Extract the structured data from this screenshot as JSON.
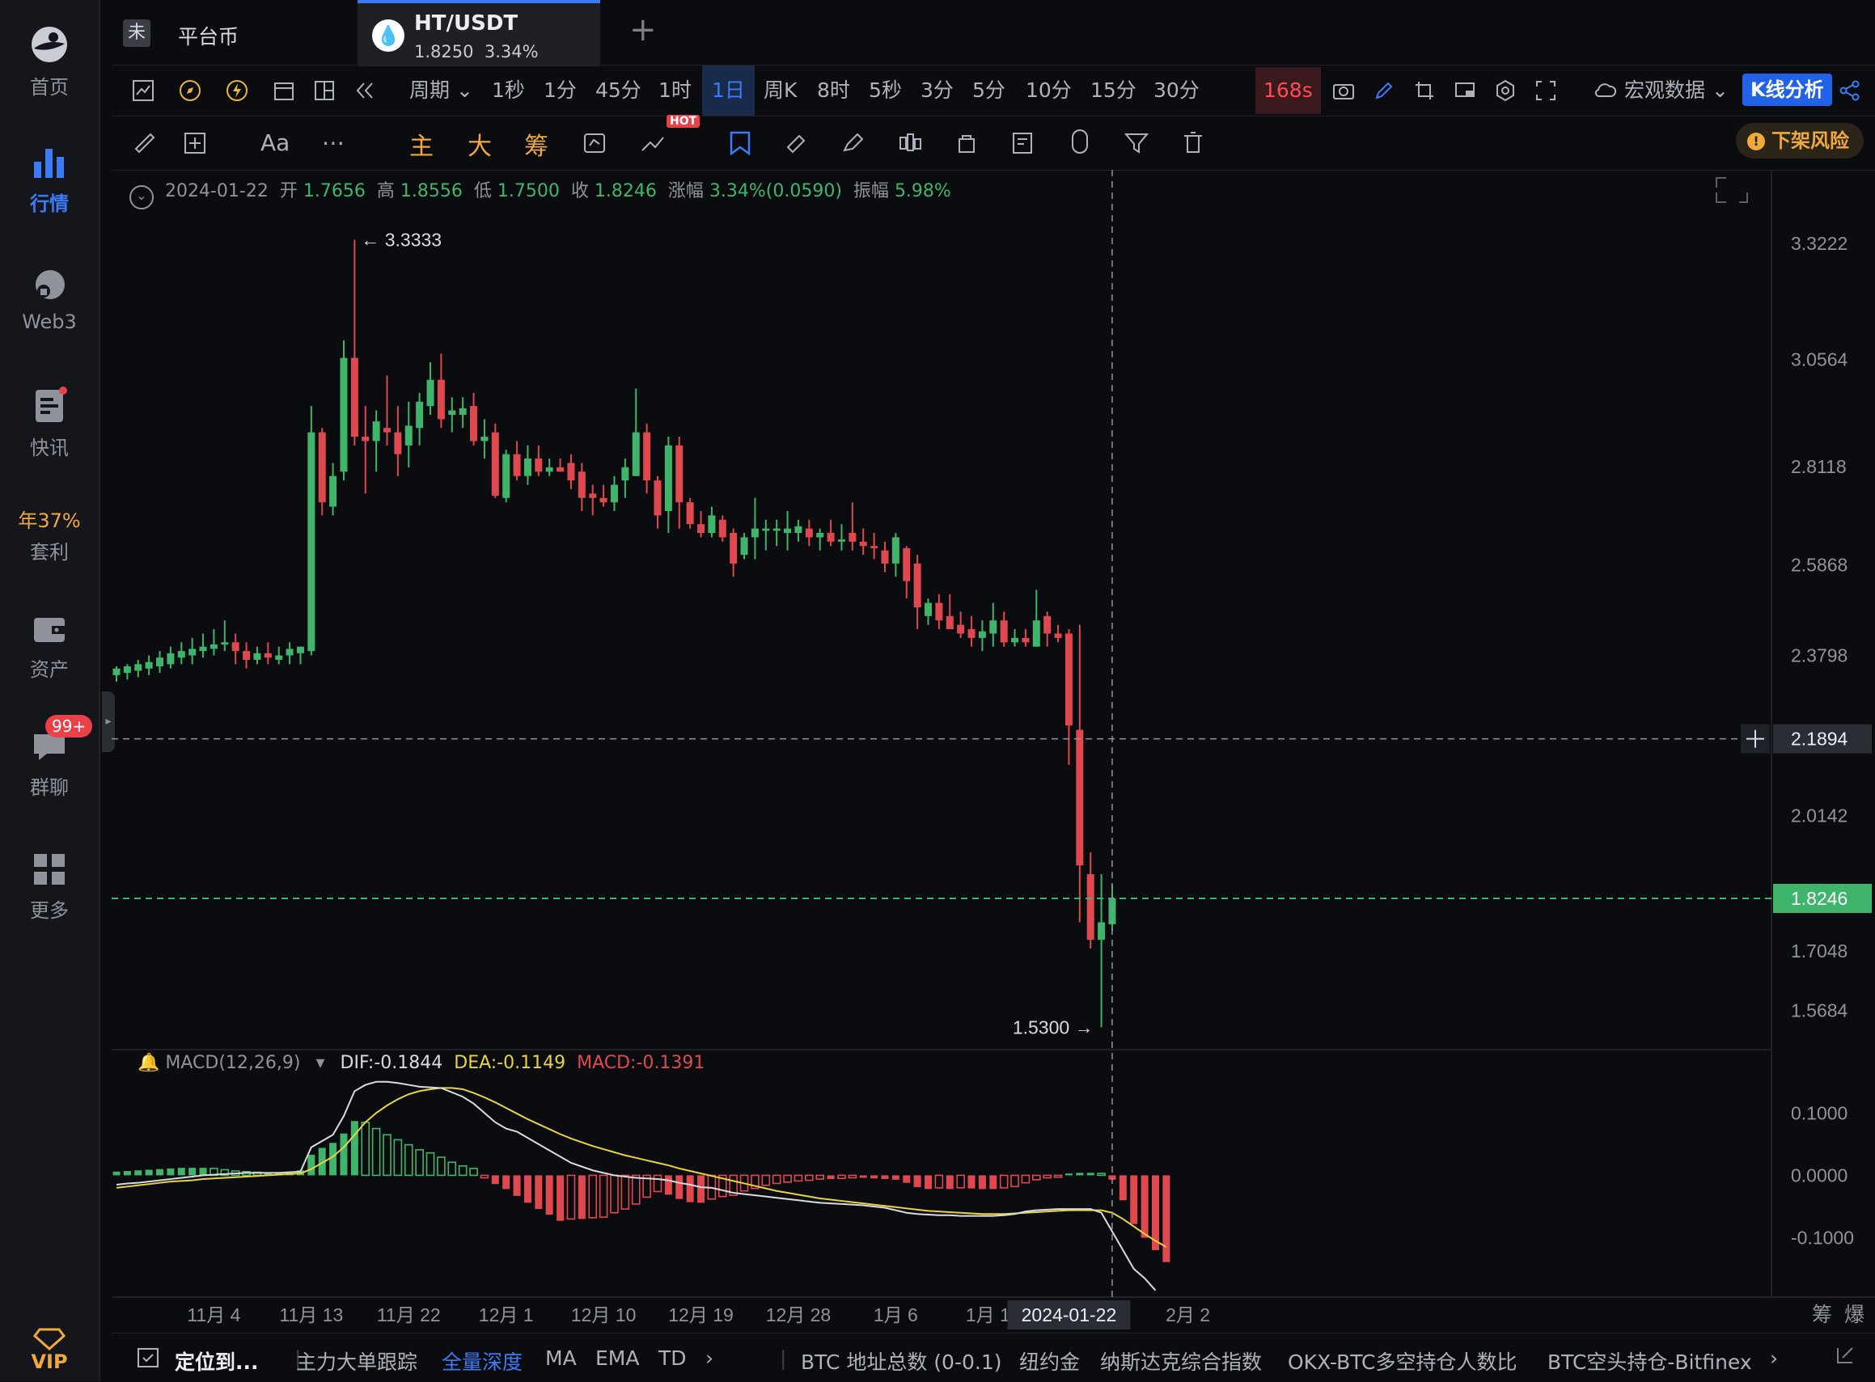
{
  "sidebar": {
    "items": [
      {
        "label": "首页",
        "icon": "home-logo-icon"
      },
      {
        "label": "行情",
        "icon": "market-bars-icon"
      },
      {
        "label": "Web3",
        "icon": "web3-icon"
      },
      {
        "label": "快讯",
        "icon": "news-icon"
      },
      {
        "label": "套利",
        "icon": "arbitrage-icon",
        "promo": "年37%"
      },
      {
        "label": "资产",
        "icon": "wallet-icon"
      },
      {
        "label": "群聊",
        "icon": "chat-icon",
        "badge": "99+"
      },
      {
        "label": "更多",
        "icon": "grid-more-icon"
      }
    ],
    "vip": "VIP"
  },
  "tabs": {
    "first": {
      "icon_char": "未",
      "label": "平台币"
    },
    "active": {
      "pair": "HT/USDT",
      "price": "1.8250",
      "change": "3.34%"
    },
    "add": "+"
  },
  "toolbar": {
    "period_label": "周期",
    "intervals": [
      "1秒",
      "1分",
      "45分",
      "1时",
      "1日",
      "周K",
      "8时",
      "5秒",
      "3分",
      "5分",
      "10分",
      "15分",
      "30分"
    ],
    "selected_interval": "1日",
    "timer": "168s",
    "macro_label": "宏观数据",
    "kline_analysis": "K线分析",
    "risk_label": "下架风险",
    "font_label": "Aa",
    "indicator_main": "主",
    "indicator_big": "大",
    "indicator_chips": "筹",
    "hot": "HOT"
  },
  "ohlc": {
    "date": "2024-01-22",
    "open_label": "开",
    "open": "1.7656",
    "high_label": "高",
    "high": "1.8556",
    "low_label": "低",
    "low": "1.7500",
    "close_label": "收",
    "close": "1.8246",
    "change_label": "涨幅",
    "change": "3.34%(0.0590)",
    "amp_label": "振幅",
    "amp": "5.98%"
  },
  "macd": {
    "label": "MACD(12,26,9)",
    "dif": "DIF:-0.1844",
    "dea": "DEA:-0.1149",
    "macd": "MACD:-0.1391"
  },
  "colors": {
    "up": "#3fb56b",
    "down": "#e0484f",
    "accent": "#3b7cf6",
    "dif": "#d9dbe0",
    "dea": "#e8d43b"
  },
  "chart_data": {
    "type": "candlestick",
    "title": "HT/USDT 1日",
    "y_ticks": [
      "3.3222",
      "3.0564",
      "2.8118",
      "2.5868",
      "2.3798",
      "2.1894",
      "2.0142",
      "1.8246",
      "1.7048",
      "1.5684"
    ],
    "y_tick_values": [
      3.3222,
      3.0564,
      2.8118,
      2.5868,
      2.3798,
      2.1894,
      2.0142,
      1.8246,
      1.7048,
      1.5684
    ],
    "ylim": [
      1.49,
      3.49
    ],
    "crosshair_price": "2.1894",
    "last_price": "1.8246",
    "high_marker": "← 3.3333",
    "low_marker": "1.5300 →",
    "x_ticks": [
      "11月 4",
      "11月 13",
      "11月 22",
      "12月 1",
      "12月 10",
      "12月 19",
      "12月 28",
      "1月 6",
      "1月 15",
      "2024-01-22",
      "2月 2"
    ],
    "x_tick_index": [
      9,
      18,
      27,
      36,
      45,
      54,
      63,
      72,
      81,
      88,
      99
    ],
    "ohlc": [
      [
        2.335,
        2.355,
        2.32,
        2.35
      ],
      [
        2.34,
        2.36,
        2.325,
        2.355
      ],
      [
        2.345,
        2.37,
        2.33,
        2.36
      ],
      [
        2.35,
        2.38,
        2.335,
        2.365
      ],
      [
        2.355,
        2.39,
        2.34,
        2.375
      ],
      [
        2.36,
        2.4,
        2.35,
        2.385
      ],
      [
        2.375,
        2.41,
        2.36,
        2.39
      ],
      [
        2.38,
        2.42,
        2.36,
        2.395
      ],
      [
        2.39,
        2.43,
        2.375,
        2.4
      ],
      [
        2.395,
        2.44,
        2.38,
        2.405
      ],
      [
        2.405,
        2.46,
        2.39,
        2.41
      ],
      [
        2.41,
        2.43,
        2.36,
        2.39
      ],
      [
        2.39,
        2.41,
        2.35,
        2.37
      ],
      [
        2.37,
        2.4,
        2.36,
        2.385
      ],
      [
        2.385,
        2.41,
        2.36,
        2.375
      ],
      [
        2.37,
        2.4,
        2.36,
        2.38
      ],
      [
        2.38,
        2.41,
        2.36,
        2.395
      ],
      [
        2.385,
        2.4,
        2.36,
        2.4
      ],
      [
        2.39,
        2.95,
        2.38,
        2.89
      ],
      [
        2.89,
        2.9,
        2.7,
        2.73
      ],
      [
        2.72,
        2.82,
        2.7,
        2.79
      ],
      [
        2.8,
        3.1,
        2.78,
        3.06
      ],
      [
        3.06,
        3.33,
        2.86,
        2.88
      ],
      [
        2.88,
        2.95,
        2.75,
        2.87
      ],
      [
        2.87,
        2.94,
        2.8,
        2.915
      ],
      [
        2.9,
        3.02,
        2.86,
        2.89
      ],
      [
        2.89,
        2.95,
        2.79,
        2.84
      ],
      [
        2.86,
        2.96,
        2.81,
        2.905
      ],
      [
        2.9,
        2.98,
        2.86,
        2.96
      ],
      [
        2.95,
        3.05,
        2.93,
        3.01
      ],
      [
        3.01,
        3.07,
        2.9,
        2.92
      ],
      [
        2.93,
        2.97,
        2.89,
        2.94
      ],
      [
        2.93,
        2.97,
        2.9,
        2.945
      ],
      [
        2.95,
        2.98,
        2.86,
        2.87
      ],
      [
        2.87,
        2.92,
        2.83,
        2.88
      ],
      [
        2.89,
        2.91,
        2.74,
        2.745
      ],
      [
        2.74,
        2.85,
        2.73,
        2.84
      ],
      [
        2.84,
        2.87,
        2.78,
        2.79
      ],
      [
        2.79,
        2.86,
        2.77,
        2.83
      ],
      [
        2.83,
        2.86,
        2.79,
        2.8
      ],
      [
        2.8,
        2.83,
        2.79,
        2.81
      ],
      [
        2.81,
        2.83,
        2.8,
        2.8
      ],
      [
        2.82,
        2.84,
        2.76,
        2.78
      ],
      [
        2.8,
        2.82,
        2.71,
        2.74
      ],
      [
        2.75,
        2.77,
        2.7,
        2.74
      ],
      [
        2.74,
        2.77,
        2.72,
        2.73
      ],
      [
        2.73,
        2.79,
        2.71,
        2.77
      ],
      [
        2.78,
        2.83,
        2.74,
        2.81
      ],
      [
        2.79,
        2.99,
        2.79,
        2.89
      ],
      [
        2.89,
        2.91,
        2.75,
        2.78
      ],
      [
        2.78,
        2.79,
        2.67,
        2.7
      ],
      [
        2.71,
        2.88,
        2.66,
        2.86
      ],
      [
        2.86,
        2.88,
        2.67,
        2.73
      ],
      [
        2.73,
        2.74,
        2.67,
        2.68
      ],
      [
        2.68,
        2.71,
        2.65,
        2.66
      ],
      [
        2.66,
        2.72,
        2.65,
        2.7
      ],
      [
        2.69,
        2.7,
        2.64,
        2.65
      ],
      [
        2.66,
        2.67,
        2.56,
        2.59
      ],
      [
        2.61,
        2.66,
        2.6,
        2.65
      ],
      [
        2.65,
        2.74,
        2.6,
        2.67
      ],
      [
        2.665,
        2.69,
        2.62,
        2.67
      ],
      [
        2.665,
        2.69,
        2.63,
        2.67
      ],
      [
        2.66,
        2.71,
        2.62,
        2.67
      ],
      [
        2.66,
        2.69,
        2.64,
        2.675
      ],
      [
        2.67,
        2.69,
        2.63,
        2.65
      ],
      [
        2.65,
        2.67,
        2.62,
        2.66
      ],
      [
        2.66,
        2.69,
        2.63,
        2.64
      ],
      [
        2.64,
        2.68,
        2.62,
        2.645
      ],
      [
        2.66,
        2.73,
        2.62,
        2.64
      ],
      [
        2.64,
        2.67,
        2.61,
        2.63
      ],
      [
        2.63,
        2.66,
        2.6,
        2.625
      ],
      [
        2.62,
        2.64,
        2.57,
        2.59
      ],
      [
        2.59,
        2.66,
        2.56,
        2.65
      ],
      [
        2.625,
        2.63,
        2.51,
        2.55
      ],
      [
        2.59,
        2.61,
        2.44,
        2.49
      ],
      [
        2.47,
        2.51,
        2.45,
        2.5
      ],
      [
        2.5,
        2.52,
        2.44,
        2.46
      ],
      [
        2.47,
        2.52,
        2.45,
        2.44
      ],
      [
        2.45,
        2.48,
        2.42,
        2.43
      ],
      [
        2.44,
        2.47,
        2.4,
        2.42
      ],
      [
        2.42,
        2.46,
        2.39,
        2.435
      ],
      [
        2.43,
        2.5,
        2.4,
        2.46
      ],
      [
        2.46,
        2.48,
        2.4,
        2.41
      ],
      [
        2.41,
        2.44,
        2.4,
        2.42
      ],
      [
        2.42,
        2.44,
        2.4,
        2.41
      ],
      [
        2.4,
        2.53,
        2.4,
        2.46
      ],
      [
        2.47,
        2.48,
        2.4,
        2.43
      ],
      [
        2.43,
        2.45,
        2.41,
        2.42
      ],
      [
        2.43,
        2.44,
        2.13,
        2.22
      ],
      [
        2.21,
        2.45,
        1.77,
        1.9
      ],
      [
        1.88,
        1.93,
        1.71,
        1.73
      ],
      [
        1.73,
        1.88,
        1.53,
        1.77
      ],
      [
        1.7656,
        1.8556,
        1.75,
        1.8246
      ]
    ],
    "macd_hist": [
      0.006,
      0.007,
      0.008,
      0.009,
      0.01,
      0.011,
      0.012,
      0.012,
      0.012,
      0.011,
      0.009,
      0.007,
      0.006,
      0.005,
      0.005,
      0.005,
      0.006,
      0.008,
      0.033,
      0.044,
      0.052,
      0.067,
      0.087,
      0.085,
      0.075,
      0.065,
      0.057,
      0.049,
      0.041,
      0.036,
      0.029,
      0.021,
      0.015,
      0.011,
      -0.004,
      -0.014,
      -0.022,
      -0.033,
      -0.044,
      -0.054,
      -0.063,
      -0.073,
      -0.07,
      -0.07,
      -0.068,
      -0.067,
      -0.06,
      -0.054,
      -0.046,
      -0.035,
      -0.026,
      -0.031,
      -0.038,
      -0.043,
      -0.044,
      -0.038,
      -0.034,
      -0.032,
      -0.025,
      -0.021,
      -0.016,
      -0.013,
      -0.011,
      -0.009,
      -0.008,
      -0.006,
      -0.006,
      -0.005,
      -0.004,
      -0.004,
      -0.005,
      -0.006,
      -0.007,
      -0.012,
      -0.019,
      -0.022,
      -0.02,
      -0.022,
      -0.02,
      -0.021,
      -0.022,
      -0.022,
      -0.02,
      -0.018,
      -0.012,
      -0.007,
      -0.004,
      -0.003,
      0.003,
      0.004,
      0.004,
      0.003,
      -0.007,
      -0.04,
      -0.078,
      -0.1,
      -0.12,
      -0.1391
    ],
    "dif": [
      -0.015,
      -0.013,
      -0.012,
      -0.01,
      -0.008,
      -0.006,
      -0.004,
      -0.002,
      0.0,
      0.001,
      0.002,
      0.003,
      0.004,
      0.004,
      0.004,
      0.004,
      0.005,
      0.006,
      0.045,
      0.055,
      0.065,
      0.095,
      0.135,
      0.145,
      0.15,
      0.15,
      0.148,
      0.145,
      0.142,
      0.141,
      0.14,
      0.133,
      0.126,
      0.115,
      0.1,
      0.085,
      0.075,
      0.07,
      0.06,
      0.05,
      0.04,
      0.03,
      0.02,
      0.014,
      0.008,
      0.004,
      0.0,
      -0.002,
      -0.004,
      -0.005,
      -0.006,
      -0.008,
      -0.012,
      -0.015,
      -0.019,
      -0.02,
      -0.024,
      -0.028,
      -0.03,
      -0.032,
      -0.034,
      -0.036,
      -0.038,
      -0.04,
      -0.042,
      -0.044,
      -0.045,
      -0.046,
      -0.047,
      -0.048,
      -0.05,
      -0.052,
      -0.056,
      -0.06,
      -0.062,
      -0.063,
      -0.064,
      -0.064,
      -0.065,
      -0.065,
      -0.065,
      -0.065,
      -0.064,
      -0.062,
      -0.058,
      -0.056,
      -0.055,
      -0.054,
      -0.054,
      -0.054,
      -0.054,
      -0.06,
      -0.09,
      -0.12,
      -0.15,
      -0.165,
      -0.1844
    ],
    "dea": [
      -0.02,
      -0.018,
      -0.016,
      -0.014,
      -0.012,
      -0.01,
      -0.009,
      -0.008,
      -0.006,
      -0.005,
      -0.004,
      -0.003,
      -0.002,
      -0.001,
      0.0,
      0.001,
      0.002,
      0.003,
      0.01,
      0.02,
      0.03,
      0.045,
      0.065,
      0.085,
      0.1,
      0.112,
      0.122,
      0.13,
      0.135,
      0.138,
      0.14,
      0.14,
      0.138,
      0.132,
      0.125,
      0.117,
      0.108,
      0.099,
      0.09,
      0.082,
      0.074,
      0.066,
      0.059,
      0.053,
      0.047,
      0.042,
      0.037,
      0.032,
      0.028,
      0.024,
      0.02,
      0.016,
      0.011,
      0.007,
      0.003,
      -0.001,
      -0.005,
      -0.009,
      -0.013,
      -0.017,
      -0.021,
      -0.025,
      -0.028,
      -0.031,
      -0.034,
      -0.037,
      -0.039,
      -0.041,
      -0.043,
      -0.045,
      -0.047,
      -0.049,
      -0.051,
      -0.053,
      -0.055,
      -0.057,
      -0.058,
      -0.059,
      -0.06,
      -0.061,
      -0.062,
      -0.062,
      -0.062,
      -0.061,
      -0.06,
      -0.059,
      -0.058,
      -0.057,
      -0.056,
      -0.056,
      -0.056,
      -0.056,
      -0.06,
      -0.07,
      -0.082,
      -0.094,
      -0.105,
      -0.1149
    ],
    "macd_ticks": [
      "0.1000",
      "0.0000",
      "-0.1000"
    ],
    "macd_tick_values": [
      0.1,
      0.0,
      -0.1
    ],
    "macd_ylim": [
      -0.19,
      0.16
    ]
  },
  "bottom": {
    "locate": "定位到...",
    "items": [
      "主力大单跟踪",
      "全量深度",
      "MA",
      "EMA",
      "TD"
    ],
    "active": "全量深度",
    "right_items": [
      "BTC 地址总数 (0-0.1)",
      "纽约金",
      "纳斯达克综合指数",
      "OKX-BTC多空持仓人数比",
      "BTC空头持仓-Bitfinex"
    ],
    "corner_labels": [
      "筹",
      "爆"
    ]
  }
}
